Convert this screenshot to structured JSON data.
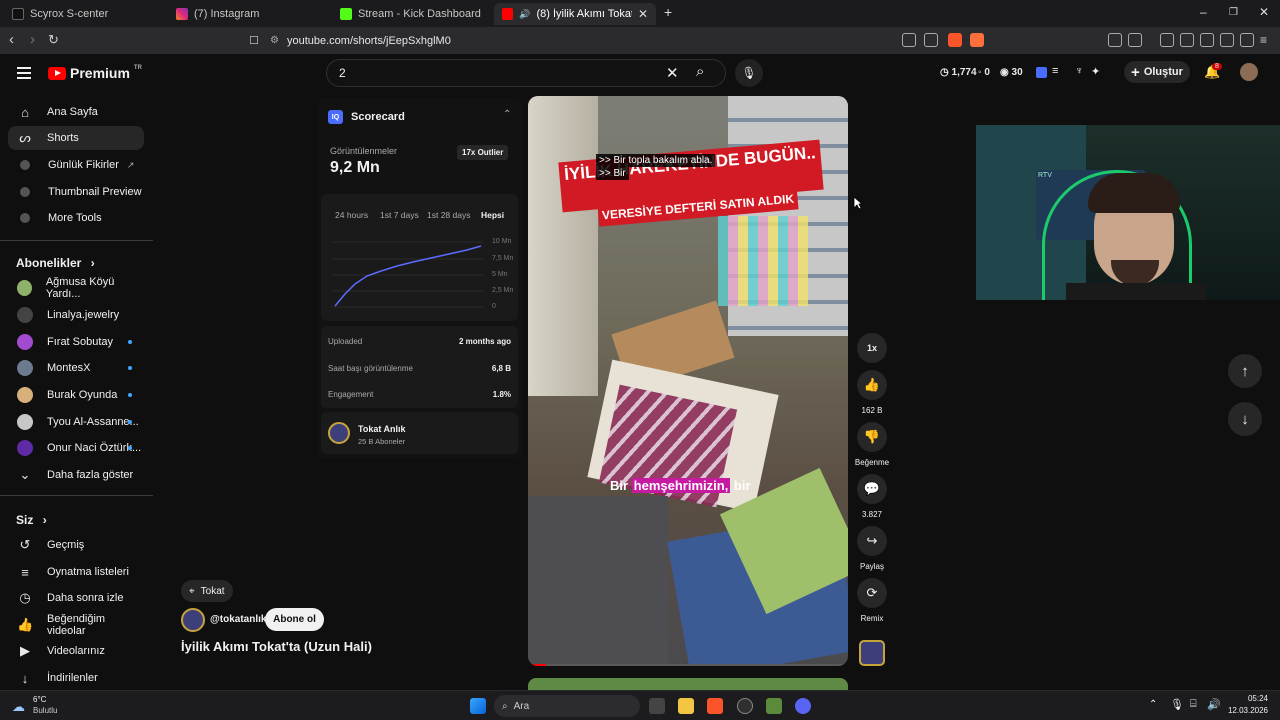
{
  "browser": {
    "tabs": [
      {
        "label": "Scyrox S-center",
        "active": false
      },
      {
        "label": "(7) Instagram",
        "active": false
      },
      {
        "label": "Stream - Kick Dashboard",
        "active": false
      },
      {
        "label": "(8) İyilik Akımı Tokat'ta (Uzun",
        "active": true
      }
    ],
    "url": "youtube.com/shorts/jEepSxhglM0",
    "window_controls": {
      "minimize": "–",
      "restore": "❐",
      "close": "✕"
    }
  },
  "youtube": {
    "logo_text": "Premium",
    "logo_region": "TR",
    "search_value": "2",
    "top_stats": {
      "views": "1,774",
      "zero": "0",
      "count": "30"
    },
    "create_label": "Oluştur",
    "notifications_count": "8"
  },
  "sidebar": {
    "main": [
      {
        "label": "Ana Sayfa",
        "icon": "home-icon",
        "active": false
      },
      {
        "label": "Shorts",
        "icon": "shorts-icon",
        "active": true
      },
      {
        "label": "Günlük Fikirler",
        "icon": "ext-icon",
        "active": false
      },
      {
        "label": "Thumbnail Preview",
        "icon": "ext-icon",
        "active": false
      },
      {
        "label": "More Tools",
        "icon": "ext-icon",
        "active": false
      }
    ],
    "subscriptions_title": "Abonelikler",
    "subscriptions": [
      {
        "label": "Ağmusa Köyü Yardı...",
        "live": false,
        "color": "#8fb26b"
      },
      {
        "label": "Linalya.jewelry",
        "live": false,
        "color": "#444444"
      },
      {
        "label": "Fırat Sobutay",
        "live": true,
        "color": "#a24bd1"
      },
      {
        "label": "MontesX",
        "live": true,
        "color": "#6b7a8f"
      },
      {
        "label": "Burak Oyunda",
        "live": true,
        "color": "#d8b07a"
      },
      {
        "label": "Tyou Al-Assanne...",
        "live": true,
        "color": "#c7c7c7"
      },
      {
        "label": "Onur Naci Öztürk...",
        "live": true,
        "color": "#5e2aa5"
      }
    ],
    "show_more": "Daha fazla göster",
    "you_title": "Siz",
    "you_items": [
      {
        "label": "Geçmiş",
        "icon": "history-icon"
      },
      {
        "label": "Oynatma listeleri",
        "icon": "playlist-icon"
      },
      {
        "label": "Daha sonra izle",
        "icon": "clock-icon"
      },
      {
        "label": "Beğendiğim videolar",
        "icon": "like-icon"
      },
      {
        "label": "Videolarınız",
        "icon": "video-icon"
      },
      {
        "label": "İndirilenler",
        "icon": "download-icon"
      }
    ]
  },
  "scorecard": {
    "title": "Scorecard",
    "badge": "IQ",
    "views_label": "Görüntülenmeler",
    "views_value": "9,2 Mn",
    "outlier_badge": "17x Outlier",
    "ranges": [
      "24 hours",
      "1st 7 days",
      "1st 28 days",
      "Hepsi"
    ],
    "active_range": "Hepsi",
    "y_ticks": [
      "10 Mn",
      "7,5 Mn",
      "5 Mn",
      "2,5 Mn",
      "0"
    ],
    "rows": [
      {
        "label": "Uploaded",
        "value": "2 months ago"
      },
      {
        "label": "Saat başı görüntülenme",
        "value": "6,8 B"
      },
      {
        "label": "Engagement",
        "value": "1.8%"
      }
    ],
    "channel_name": "Tokat Anlık",
    "channel_subs": "25 B Aboneler"
  },
  "video": {
    "banner_line1": "İYİLİK HAREKETİNDE BUGÜN..",
    "banner_line2": "VERESİYE DEFTERİ SATIN ALDIK",
    "caption_line1": ">> Bir topla bakalım abla.",
    "caption_line2": ">> Bir",
    "subtitle_plain": "Bir ",
    "subtitle_highlight": "hemşehrimizin,",
    "subtitle_tail": " bir"
  },
  "actions": {
    "speed": "1x",
    "likes": "162 B",
    "dislike_label": "Beğenme",
    "comments": "3.827",
    "share_label": "Paylaş",
    "remix_label": "Remix"
  },
  "short_meta": {
    "location": "Tokat",
    "handle": "@tokatanlık",
    "subscribe_label": "Abone ol",
    "title": "İyilik Akımı Tokat'ta (Uzun Hali)"
  },
  "webcam": {
    "wall_text": "RTV"
  },
  "taskbar": {
    "weather_temp": "6°C",
    "weather_desc": "Bulutlu",
    "search_label": "Ara",
    "time": "05:24",
    "date": "12.03.2026"
  }
}
